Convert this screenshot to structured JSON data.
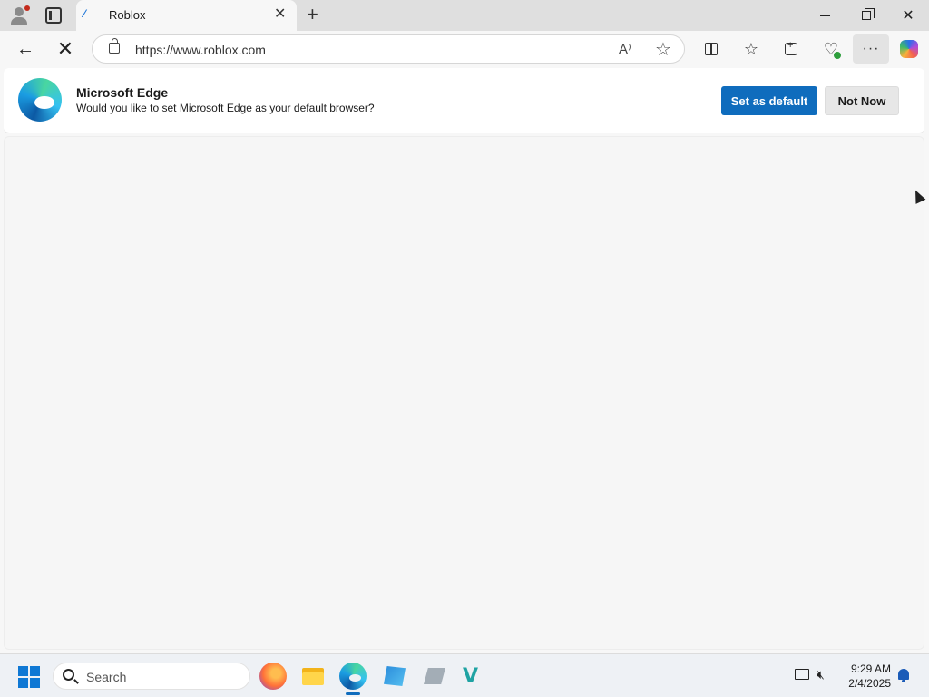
{
  "tab": {
    "title": "Roblox",
    "favicon": "roblox-favicon"
  },
  "window_controls": {
    "minimize": "minimize",
    "maximize": "maximize",
    "close": "close"
  },
  "address": {
    "url": "https://www.roblox.com"
  },
  "infobar": {
    "title": "Microsoft Edge",
    "message": "Would you like to set Microsoft Edge as your default browser?",
    "primary_label": "Set as default",
    "secondary_label": "Not Now"
  },
  "taskbar": {
    "search_placeholder": "Search",
    "apps": [
      "firefox-icon",
      "file-explorer-icon",
      "edge-icon",
      "app-icon",
      "app-icon",
      "app-icon"
    ],
    "time": "9:29 AM",
    "date": "2/4/2025"
  },
  "colors": {
    "accent": "#0f6cbd",
    "tabbar": "#dfdfdf",
    "page": "#f6f6f6"
  }
}
